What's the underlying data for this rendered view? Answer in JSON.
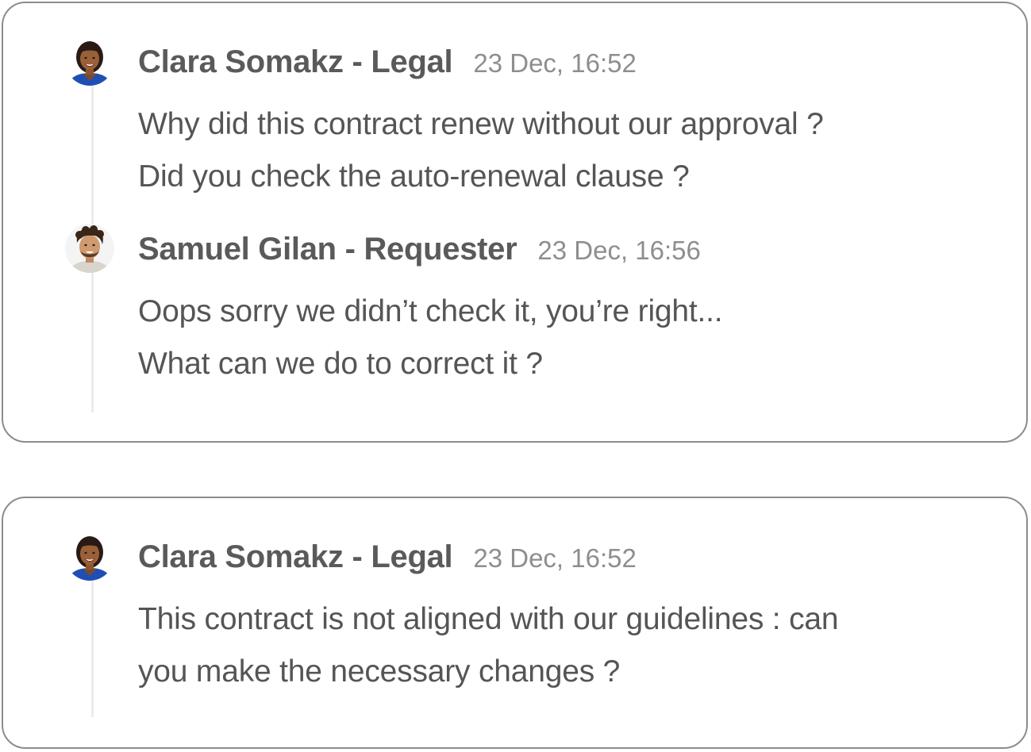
{
  "threads": [
    {
      "comments": [
        {
          "author": "Clara Somakz - Legal",
          "timestamp": "23 Dec, 16:52",
          "avatar_icon": "avatar-woman-icon",
          "lines": [
            "Why did this contract renew without our approval ?",
            "Did you check the auto-renewal clause ?"
          ]
        },
        {
          "author": "Samuel Gilan - Requester",
          "timestamp": "23 Dec, 16:56",
          "avatar_icon": "avatar-man-icon",
          "lines": [
            "Oops sorry we didn’t check it, you’re right...",
            "What can we do to correct it ?"
          ]
        }
      ]
    },
    {
      "comments": [
        {
          "author": "Clara Somakz - Legal",
          "timestamp": "23 Dec, 16:52",
          "avatar_icon": "avatar-woman-icon",
          "lines": [
            "This contract is not aligned with our guidelines : can",
            "you make the necessary changes ?"
          ]
        }
      ]
    }
  ],
  "colors": {
    "card_border": "#8c8c8c",
    "thread_line": "#ececec",
    "author_text": "#5a5a5a",
    "timestamp_text": "#8e8e8e",
    "body_text": "#555555"
  }
}
